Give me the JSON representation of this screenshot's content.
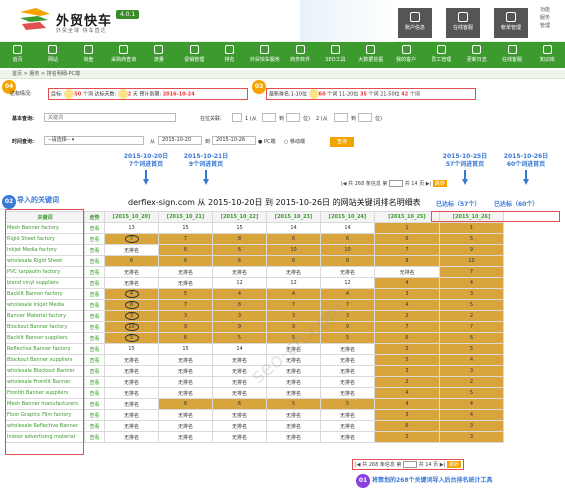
{
  "header": {
    "brand": "外贸快车",
    "version": "4.0.1",
    "slogan": "外贸全球  快车直达",
    "buttons": [
      "账户信息",
      "在线客服",
      "帐单管理"
    ],
    "right_lines": [
      "功能",
      "服务",
      "管理"
    ]
  },
  "nav": [
    "首页",
    "网站",
    "询盘",
    "采购商查询",
    "流量",
    "促销管理",
    "排名",
    "外贸快车服务",
    "商务软件",
    "SEO工具",
    "大数据挖掘",
    "我的客户",
    "员工管理",
    "更新日志",
    "在线客服",
    "知识库"
  ],
  "breadcrumb": "首页 > 服务 > 排名明细-PC端",
  "status": {
    "label": "达标情况:",
    "target_label": "目标:",
    "target_value": "50",
    "target_unit": "个词",
    "days_label": "达标天数:",
    "days_value": "2",
    "days_unit": "天",
    "expire_label": "预计到期:",
    "expire_value": "2016-10-24",
    "latest_label": "最新排名:1-10位",
    "r1": "60",
    "r1u": "个词",
    "r2l": "11-20位",
    "r2": "35",
    "r2u": "个词",
    "r3l": "21-50位",
    "r3": "42",
    "r3u": "个词"
  },
  "search": {
    "basic_label": "基本查询:",
    "keyword_placeholder": "关键词",
    "range_label": "在位关联:",
    "r1a": "1 (从",
    "r1b": "到",
    "r1c": "位)",
    "r2a": "2 (从",
    "r2b": "到",
    "r2c": "位)",
    "time_label": "时间查询:",
    "select_value": "--请选择--",
    "from_label": "从",
    "date_from": "2015-10-20",
    "to_label": "到",
    "date_to": "2015-10-26",
    "pc_label": "PC端",
    "mobile_label": "移动端",
    "query_btn": "查询"
  },
  "annotations": {
    "d1": "2015-10-20日",
    "d1b": "7个词进首页",
    "d2": "2015-10-21日",
    "d2b": "9个词进首页",
    "d3": "2015-10-25日",
    "d3b": "57个词进首页",
    "d4": "2015-10-26日",
    "d4b": "60个词进首页",
    "ok1": "已达标（57个）",
    "ok2": "已达标（60个）",
    "badge1": "04",
    "badge2": "03",
    "badge3": "02",
    "badge4": "01",
    "import_label": "导入的关键词",
    "foot_label": "将策划的268个关键词导入后台排名统计工具"
  },
  "pager": {
    "text1": "共 268 条信息 第",
    "page": "1",
    "text2": "共 14 页",
    "go": "跳转"
  },
  "table_title": "derflex-sign.com 从 2015-10-20日 到 2015-10-26日 的网站关键词排名明细表",
  "table": {
    "headers": [
      "关键词",
      "走势",
      "[2015_10_20]",
      "[2015_10_21]",
      "[2015_10_22]",
      "[2015_10_23]",
      "[2015_10_24]",
      "[2015_10_25]",
      "[2015_10_26]"
    ],
    "rows": [
      [
        "Mesh Banner factory",
        "查看",
        "13",
        "15",
        "15",
        "14",
        "14",
        "1",
        "1"
      ],
      [
        "Rigid Sheet factory",
        "查看",
        "7",
        "7",
        "8",
        "6",
        "6",
        "6",
        "5"
      ],
      [
        "Inkjet Media factory",
        "查看",
        "无排名",
        "8",
        "6",
        "10",
        "10",
        "7",
        "9"
      ],
      [
        "wholesale Rigid Sheet",
        "查看",
        "6",
        "6",
        "6",
        "8",
        "8",
        "8",
        "10"
      ],
      [
        "PVC tarpaulin factory",
        "查看",
        "无排名",
        "无排名",
        "无排名",
        "无排名",
        "无排名",
        "无排名",
        "7"
      ],
      [
        "blend vinyl suppliers",
        "查看",
        "无排名",
        "无排名",
        "12",
        "12",
        "12",
        "4",
        "4"
      ],
      [
        "Backlit Banner factory",
        "查看",
        "4",
        "5",
        "4",
        "4",
        "4",
        "3",
        "3"
      ],
      [
        "wholesale Inkjet Media",
        "查看",
        "8",
        "7",
        "8",
        "7",
        "7",
        "4",
        "5"
      ],
      [
        "Banner Material factory",
        "查看",
        "3",
        "3",
        "3",
        "3",
        "3",
        "2",
        "2"
      ],
      [
        "Blockout Banner factory",
        "查看",
        "10",
        "9",
        "9",
        "9",
        "9",
        "7",
        "7"
      ],
      [
        "Backlit Banner suppliers",
        "查看",
        "5",
        "6",
        "5",
        "5",
        "5",
        "6",
        "6"
      ],
      [
        "Reflective Banner factory",
        "查看",
        "15",
        "15",
        "14",
        "无排名",
        "无排名",
        "5",
        "5"
      ],
      [
        "Blockout Banner suppliers",
        "查看",
        "无排名",
        "无排名",
        "无排名",
        "无排名",
        "无排名",
        "5",
        "4"
      ],
      [
        "wholesale Blockout Banner",
        "查看",
        "无排名",
        "无排名",
        "无排名",
        "无排名",
        "无排名",
        "3",
        "3"
      ],
      [
        "wholesale Frontlit Banner",
        "查看",
        "无排名",
        "无排名",
        "无排名",
        "无排名",
        "无排名",
        "2",
        "2"
      ],
      [
        "Frontlit Banner suppliers",
        "查看",
        "无排名",
        "无排名",
        "无排名",
        "无排名",
        "无排名",
        "4",
        "5"
      ],
      [
        "Mesh Banner manufacturers",
        "查看",
        "无排名",
        "6",
        "6",
        "5",
        "5",
        "4",
        "4"
      ],
      [
        "Floor Graphic Film factory",
        "查看",
        "无排名",
        "无排名",
        "无排名",
        "无排名",
        "无排名",
        "3",
        "4"
      ],
      [
        "wholesale Reflective Banner",
        "查看",
        "无排名",
        "无排名",
        "无排名",
        "无排名",
        "无排名",
        "6",
        "3"
      ],
      [
        "Indoor advertising material",
        "查看",
        "无排名",
        "无排名",
        "无排名",
        "无排名",
        "无排名",
        "2",
        "3"
      ]
    ],
    "circled": [
      [
        1,
        2
      ],
      [
        6,
        2
      ],
      [
        7,
        2
      ],
      [
        8,
        2
      ],
      [
        9,
        2
      ],
      [
        10,
        2
      ]
    ]
  },
  "watermark": "seo-ch.com",
  "colors": {
    "nav_green": "#3c9a2e",
    "rank_gold": "#d8a53c",
    "badge_orange": "#f4a300",
    "annotation_blue": "#3a78d6",
    "highlight_red": "#e05050"
  }
}
